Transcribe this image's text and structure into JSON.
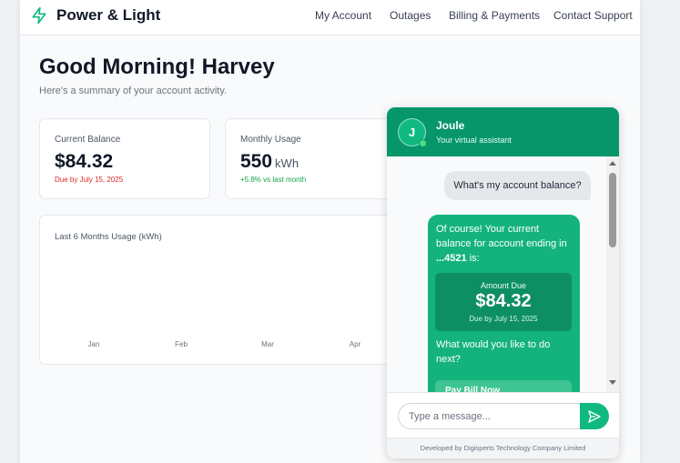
{
  "brand": {
    "name": "Power & Light",
    "icon": "lightning-bolt-icon",
    "accent": "#10b981"
  },
  "nav": {
    "items": [
      "My Account",
      "Outages",
      "Billing & Payments",
      "Contact Support"
    ]
  },
  "greeting": {
    "title": "Good Morning! Harvey",
    "subtitle": "Here's a summary of your account activity."
  },
  "cards": {
    "balance": {
      "label": "Current Balance",
      "value": "$84.32",
      "note": "Due by July 15, 2025",
      "note_color": "#dc2626"
    },
    "usage": {
      "label": "Monthly Usage",
      "value": "550",
      "unit": "kWh",
      "note": "+5.8% vs last month",
      "note_color": "#16a34a"
    }
  },
  "usage_chart": {
    "title": "Last 6 Months Usage (kWh)",
    "visible_months": [
      "Jan",
      "Feb",
      "Mar",
      "Apr"
    ]
  },
  "chat": {
    "assistant_name": "Joule",
    "assistant_subtitle": "Your virtual assistant",
    "avatar_letter": "J",
    "user_message": "What's my account balance?",
    "bot_intro": "Of course! Your current balance for account ending in ",
    "account_suffix": "...4521",
    "bot_intro_end": " is:",
    "amount_label": "Amount Due",
    "amount_value": "$84.32",
    "amount_due": "Due by July 15, 2025",
    "bot_question": "What would you like to do next?",
    "action_button": "Pay Bill Now",
    "input_placeholder": "Type a message...",
    "footer": "Developed by Digisperts Technology Company Limited",
    "header_color": "#079669"
  }
}
